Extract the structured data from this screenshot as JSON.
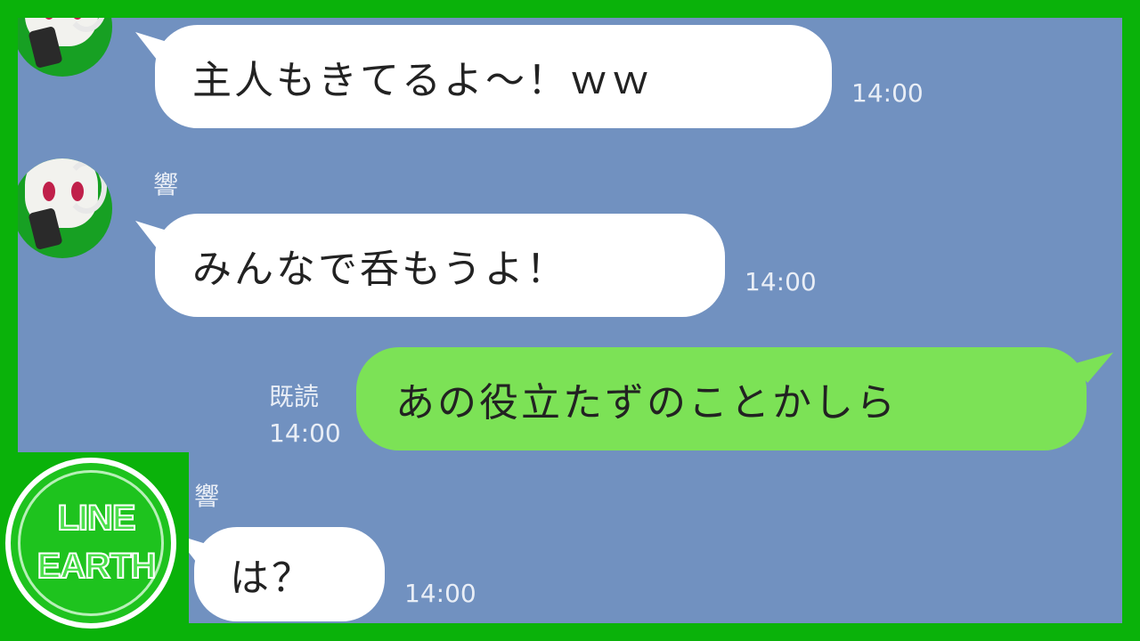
{
  "messages": [
    {
      "sender": "",
      "text": "主人もきてるよ〜！ｗｗ",
      "time": "14:00"
    },
    {
      "sender": "響",
      "text": "みんなで呑もうよ！",
      "time": "14:00"
    },
    {
      "sender": "me",
      "text": "あの役立たずのことかしら",
      "read_label": "既読",
      "time": "14:00"
    },
    {
      "sender": "響",
      "text": "は？",
      "time": "14:00"
    }
  ],
  "logo": {
    "line1": "LINE",
    "line2": "EARTH"
  },
  "colors": {
    "frame": "#0ab20a",
    "chat_bg": "#7191c0",
    "incoming_bubble": "#ffffff",
    "outgoing_bubble": "#7ce256"
  }
}
